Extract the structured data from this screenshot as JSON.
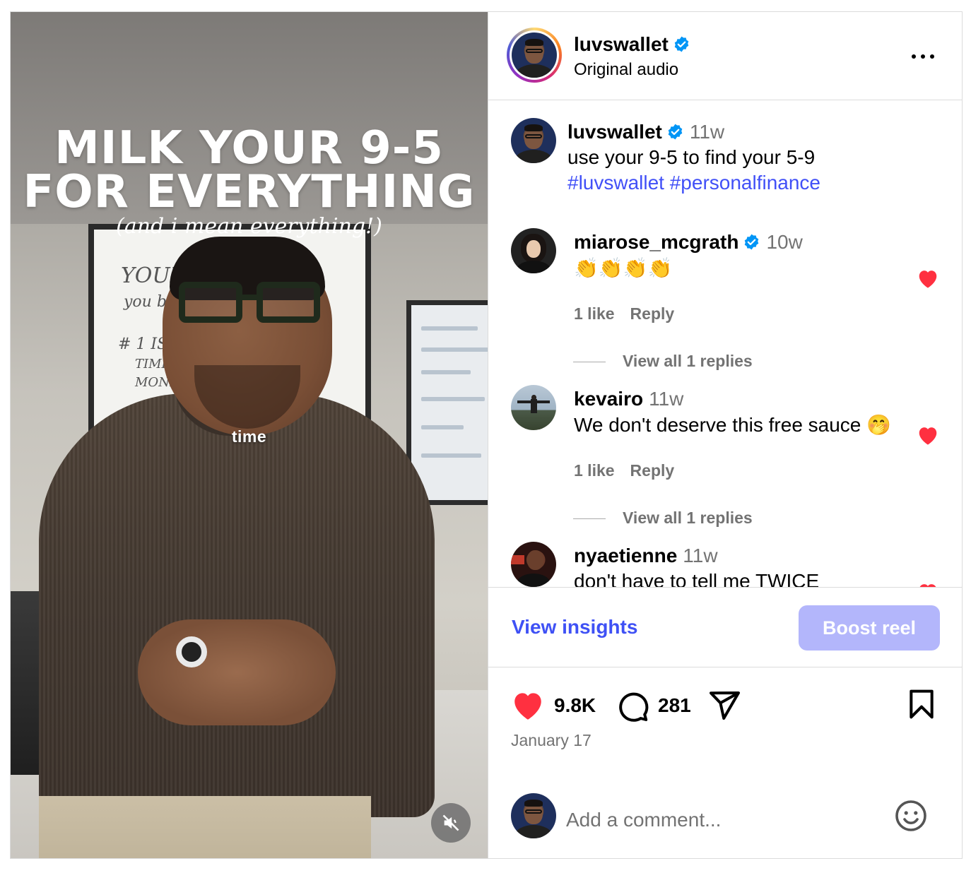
{
  "video": {
    "title_line1": "MILK YOUR 9-5",
    "title_line2": "FOR EVERYTHING",
    "subtitle": "(and i mean everything!)",
    "caption": "time",
    "whiteboard_lines": [
      "YOUR",
      "you b",
      "# 1 ISS",
      "TIME",
      "MONEY"
    ]
  },
  "header": {
    "username": "luvswallet",
    "audio": "Original audio",
    "verified": true
  },
  "post": {
    "username": "luvswallet",
    "time": "11w",
    "text": "use your 9-5 to find your 5-9",
    "hashtags": "#luvswallet #personalfinance"
  },
  "comments": [
    {
      "username": "miarose_mcgrath",
      "verified": true,
      "time": "10w",
      "text": "👏👏👏👏",
      "likes": "1 like",
      "reply_label": "Reply",
      "view_replies": "View all 1 replies",
      "liked": true
    },
    {
      "username": "kevairo",
      "verified": false,
      "time": "11w",
      "text": "We don't deserve this free sauce 🤭",
      "likes": "1 like",
      "reply_label": "Reply",
      "view_replies": "View all 1 replies",
      "liked": true
    },
    {
      "username": "nyaetienne",
      "verified": false,
      "time": "11w",
      "text": "don't have to tell me TWICE",
      "liked": true
    }
  ],
  "actions": {
    "view_insights": "View insights",
    "boost": "Boost reel",
    "likes_count": "9.8K",
    "comments_count": "281",
    "date": "January 17"
  },
  "add_comment": {
    "placeholder": "Add a comment..."
  },
  "colors": {
    "like_red": "#ff3040",
    "link_blue": "#3f51f5",
    "hashtag_blue": "#4150f7",
    "boost_bg": "#b3b6fb",
    "verified_blue": "#0095f6"
  },
  "icons": [
    "volume-off-icon",
    "more-icon",
    "verified-icon",
    "heart-icon",
    "comment-icon",
    "share-icon",
    "bookmark-icon",
    "emoji-icon"
  ]
}
